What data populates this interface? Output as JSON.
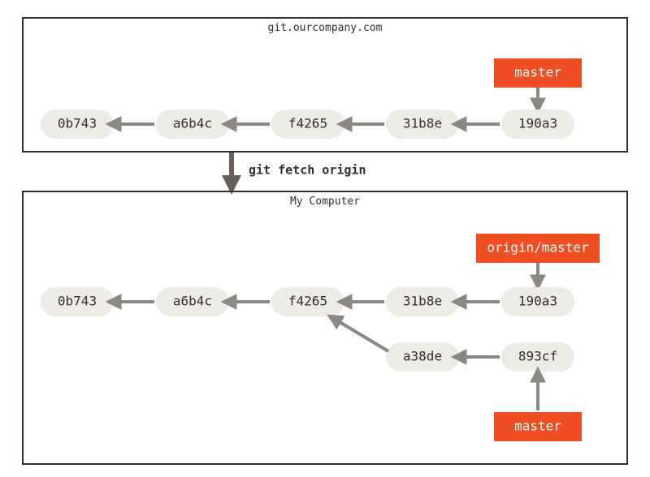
{
  "boxes": {
    "top": {
      "title": "git.ourcompany.com"
    },
    "bottom": {
      "title": "My Computer"
    }
  },
  "fetch_label": "git fetch origin",
  "top_commits": {
    "c0": "0b743",
    "c1": "a6b4c",
    "c2": "f4265",
    "c3": "31b8e",
    "c4": "190a3"
  },
  "top_branch": {
    "master": "master"
  },
  "bottom_commits": {
    "c0": "0b743",
    "c1": "a6b4c",
    "c2": "f4265",
    "c3": "31b8e",
    "c4": "190a3",
    "c5": "a38de",
    "c6": "893cf"
  },
  "bottom_branch": {
    "origin_master": "origin/master",
    "master": "master"
  }
}
